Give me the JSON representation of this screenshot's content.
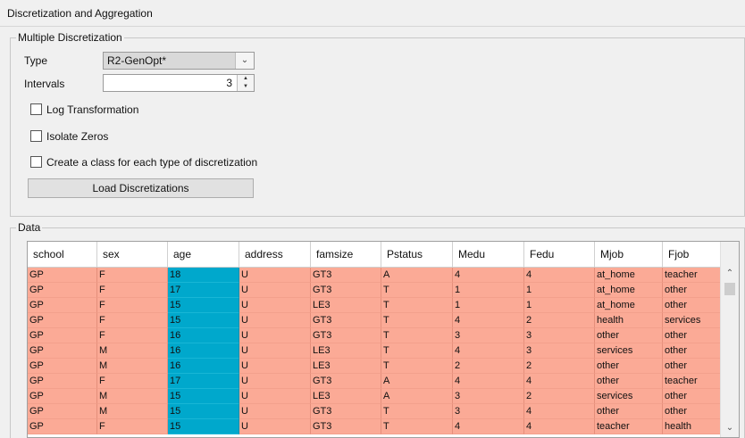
{
  "window": {
    "title": "Discretization and Aggregation"
  },
  "discretization": {
    "group_label": "Multiple Discretization",
    "type_label": "Type",
    "type_value": "R2-GenOpt*",
    "intervals_label": "Intervals",
    "intervals_value": "3",
    "log_transformation_label": "Log Transformation",
    "log_transformation_checked": false,
    "isolate_zeros_label": "Isolate Zeros",
    "isolate_zeros_checked": false,
    "create_class_label": "Create a class for each type of discretization",
    "create_class_checked": false,
    "load_button_label": "Load Discretizations"
  },
  "data_table": {
    "group_label": "Data",
    "columns": [
      "school",
      "sex",
      "age",
      "address",
      "famsize",
      "Pstatus",
      "Medu",
      "Fedu",
      "Mjob",
      "Fjob"
    ],
    "highlight_color": "#00a8cc",
    "row_color": "#fbaa96",
    "rows": [
      [
        "GP",
        "F",
        "18",
        "U",
        "GT3",
        "A",
        "4",
        "4",
        "at_home",
        "teacher"
      ],
      [
        "GP",
        "F",
        "17",
        "U",
        "GT3",
        "T",
        "1",
        "1",
        "at_home",
        "other"
      ],
      [
        "GP",
        "F",
        "15",
        "U",
        "LE3",
        "T",
        "1",
        "1",
        "at_home",
        "other"
      ],
      [
        "GP",
        "F",
        "15",
        "U",
        "GT3",
        "T",
        "4",
        "2",
        "health",
        "services"
      ],
      [
        "GP",
        "F",
        "16",
        "U",
        "GT3",
        "T",
        "3",
        "3",
        "other",
        "other"
      ],
      [
        "GP",
        "M",
        "16",
        "U",
        "LE3",
        "T",
        "4",
        "3",
        "services",
        "other"
      ],
      [
        "GP",
        "M",
        "16",
        "U",
        "LE3",
        "T",
        "2",
        "2",
        "other",
        "other"
      ],
      [
        "GP",
        "F",
        "17",
        "U",
        "GT3",
        "A",
        "4",
        "4",
        "other",
        "teacher"
      ],
      [
        "GP",
        "M",
        "15",
        "U",
        "LE3",
        "A",
        "3",
        "2",
        "services",
        "other"
      ],
      [
        "GP",
        "M",
        "15",
        "U",
        "GT3",
        "T",
        "3",
        "4",
        "other",
        "other"
      ],
      [
        "GP",
        "F",
        "15",
        "U",
        "GT3",
        "T",
        "4",
        "4",
        "teacher",
        "health"
      ]
    ]
  }
}
